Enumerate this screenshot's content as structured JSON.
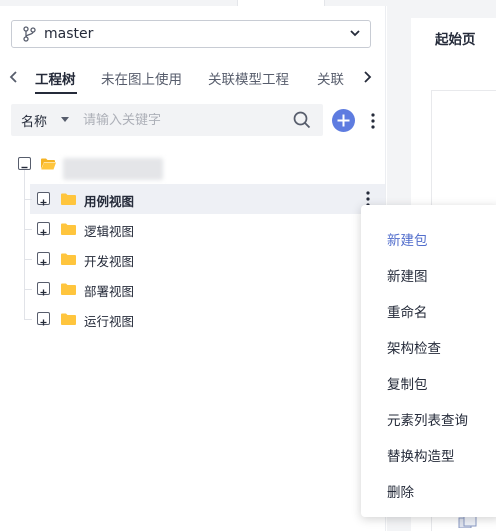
{
  "branch_selector": {
    "icon": "git-branch-icon",
    "value": "master",
    "caret": "chevron-down-icon"
  },
  "explorer_tabs": {
    "items": [
      {
        "label": "工程树",
        "active": true
      },
      {
        "label": "未在图上使用",
        "active": false
      },
      {
        "label": "关联模型工程",
        "active": false
      },
      {
        "label": "关联",
        "active": false
      }
    ],
    "prev_icon": "chevron-left-icon",
    "next_icon": "chevron-right-icon"
  },
  "search": {
    "field_label": "名称",
    "field_icon": "caret-down-icon",
    "placeholder": "请输入关键字",
    "icon": "search-icon"
  },
  "toolbar": {
    "add_icon": "plus-icon",
    "more_icon": "more-vertical-icon"
  },
  "tree": {
    "root": {
      "expander": "minus",
      "icon": "folder-open-icon"
    },
    "nodes": [
      {
        "label": "用例视图",
        "selected": true
      },
      {
        "label": "逻辑视图",
        "selected": false
      },
      {
        "label": "开发视图",
        "selected": false
      },
      {
        "label": "部署视图",
        "selected": false
      },
      {
        "label": "运行视图",
        "selected": false
      }
    ]
  },
  "right_panel": {
    "tab_title": "起始页"
  },
  "context_menu": {
    "items": [
      {
        "label": "新建包",
        "active": true
      },
      {
        "label": "新建图",
        "active": false
      },
      {
        "label": "重命名",
        "active": false
      },
      {
        "label": "架构检查",
        "active": false
      },
      {
        "label": "复制包",
        "active": false
      },
      {
        "label": "元素列表查询",
        "active": false
      },
      {
        "label": "替换构造型",
        "active": false
      },
      {
        "label": "删除",
        "active": false
      }
    ]
  },
  "colors": {
    "accent": "#5e7ce0",
    "menu_active": "#526ecc",
    "folder": "#ffc53d",
    "selected_row": "#eef0f5",
    "text": "#252b3a"
  }
}
